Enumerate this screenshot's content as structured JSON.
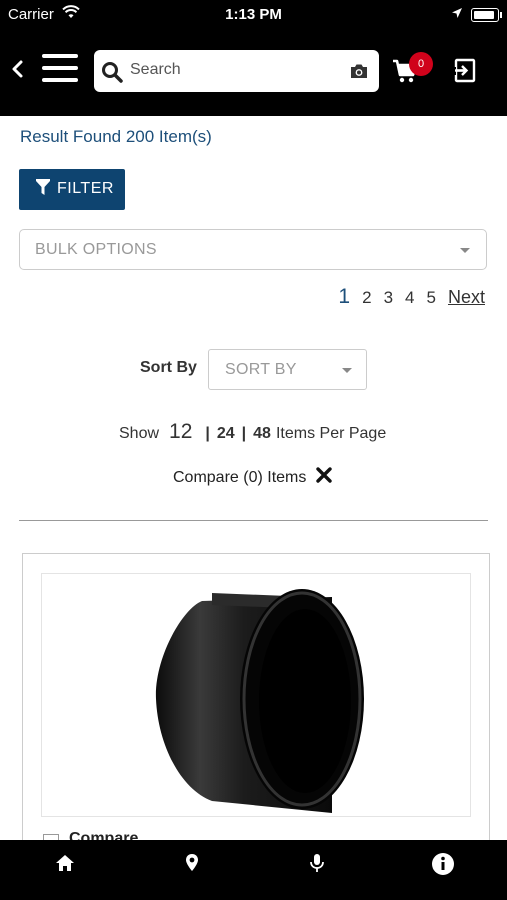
{
  "status_bar": {
    "carrier": "Carrier",
    "time": "1:13 PM"
  },
  "header": {
    "search_placeholder": "Search",
    "cart_count": "0",
    "icons": [
      "back-chevron-icon",
      "hamburger-menu-icon",
      "search-icon",
      "camera-icon",
      "cart-icon",
      "logout-icon"
    ]
  },
  "results": {
    "text": "Result Found 200 Item(s)"
  },
  "filter": {
    "label": "FILTER"
  },
  "bulk_options": {
    "label": "BULK OPTIONS"
  },
  "pagination": {
    "pages": [
      "1",
      "2",
      "3",
      "4",
      "5"
    ],
    "current": "1",
    "next": "Next"
  },
  "sort": {
    "label": "Sort By",
    "placeholder": "SORT BY"
  },
  "show": {
    "label": "Show",
    "options": [
      "12",
      "24",
      "48"
    ],
    "selected": "12",
    "suffix": "Items Per Page"
  },
  "compare": {
    "text": "Compare (0) Items"
  },
  "product": {
    "compare_label": "Compare"
  },
  "tab_bar": {
    "icons": [
      "home-icon",
      "location-pin-icon",
      "microphone-icon",
      "info-icon"
    ]
  },
  "colors": {
    "primary": "#0e4470",
    "link": "#1d4f7a",
    "badge": "#d0021b",
    "bar": "#000000"
  }
}
